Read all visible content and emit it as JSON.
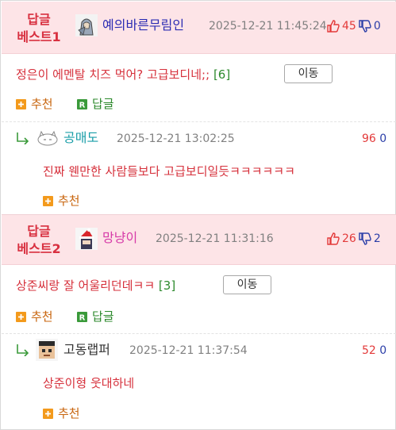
{
  "comments": [
    {
      "badge_line1": "답글",
      "badge_line2": "베스트1",
      "avatar": "hooded-figure-avatar",
      "nickname": "예의바른무림인",
      "nickname_color": "#2b2bb3",
      "datetime": "2025-12-21 11:45:24",
      "upvotes": "45",
      "downvotes": "0",
      "title": "정은이 에멘탈 치즈 먹어? 고급보디네;;",
      "reply_count": "[6]",
      "move_label": "이동",
      "recommend_label": "추천",
      "reply_label": "답글",
      "reply": {
        "avatar": "cat-avatar",
        "nickname": "공매도",
        "nickname_color": "#1a9ea8",
        "datetime": "2025-12-21 13:02:25",
        "upvotes": "96",
        "downvotes": "0",
        "text": "진짜 웬만한 사람들보다 고급보디일듯ㅋㅋㅋㅋㅋㅋ",
        "recommend_label": "추천"
      }
    },
    {
      "badge_line1": "답글",
      "badge_line2": "베스트2",
      "avatar": "santa-hat-avatar",
      "nickname": "망냥이",
      "nickname_color": "#d63aa8",
      "datetime": "2025-12-21 11:31:16",
      "upvotes": "26",
      "downvotes": "2",
      "title": "상준씨랑 잘 어울리던데ㅋㅋ",
      "reply_count": "[3]",
      "move_label": "이동",
      "recommend_label": "추천",
      "reply_label": "답글",
      "reply": {
        "avatar": "pixel-face-avatar",
        "nickname": "고동랩퍼",
        "nickname_color": "#333333",
        "datetime": "2025-12-21 11:37:54",
        "upvotes": "52",
        "downvotes": "0",
        "text": "상준이형 웃대하네",
        "recommend_label": "추천"
      }
    }
  ],
  "colors": {
    "accent_red": "#d6303b",
    "header_bg": "#fde4e7",
    "up_red": "#e33a3a",
    "down_blue": "#2b3ea8",
    "orange": "#c8650e",
    "green": "#2d8a2d"
  }
}
